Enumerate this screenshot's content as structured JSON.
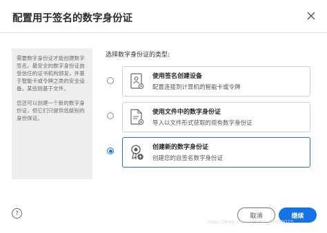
{
  "dialog": {
    "title": "配置用于签名的数字身份证",
    "close_icon": "close-icon"
  },
  "info_panel": {
    "paragraph1": "需要数字身份证才能创建数字签名。最安全的数字身份证由受信任的证书机构颁发，并基于智能卡或令牌之类的安全设备。某些则基于文件。",
    "paragraph2": "您还可以创建一个新的数字身份证，但它们只提供低级别的身份保证。"
  },
  "prompt": "选择数字身份证的类型:",
  "options": [
    {
      "title": "使用签名创建设备",
      "description": "配置连接到计算机的智能卡或令牌",
      "icon": "device-certificate-icon",
      "selected": false
    },
    {
      "title": "使用文件中的数字身份证",
      "description": "导入以文件形式获取的现有数字身份证",
      "icon": "file-certificate-icon",
      "selected": false
    },
    {
      "title": "创建新的数字身份证",
      "description": "创建您的自签名数字身份证",
      "icon": "new-certificate-icon",
      "selected": true
    }
  ],
  "footer": {
    "help_label": "?",
    "cancel_label": "取消",
    "continue_label": "继续"
  },
  "watermark": "https://blog.csdn.net/m0_49310025",
  "colors": {
    "accent": "#1473e6",
    "panel_bg": "#eeeeee"
  }
}
